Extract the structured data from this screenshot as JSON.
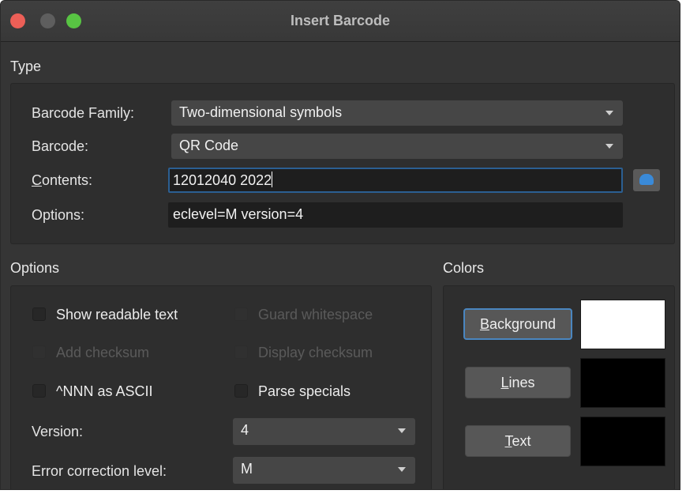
{
  "window": {
    "title": "Insert Barcode"
  },
  "type_section": {
    "label": "Type",
    "family_label": "Barcode Family:",
    "family_value": "Two-dimensional symbols",
    "barcode_label": "Barcode:",
    "barcode_value": "QR Code",
    "contents_label_rest": "ontents:",
    "contents_label_accel": "C",
    "contents_value": "12012040 2022",
    "options_label": "Options:",
    "options_value": "eclevel=M version=4"
  },
  "options_section": {
    "label": "Options",
    "checkboxes": [
      {
        "label": "Show readable text",
        "enabled": true,
        "checked": false
      },
      {
        "label": "Guard whitespace",
        "enabled": false,
        "checked": false
      },
      {
        "label": "Add checksum",
        "enabled": false,
        "checked": false
      },
      {
        "label": "Display checksum",
        "enabled": false,
        "checked": false
      },
      {
        "label": "^NNN as ASCII",
        "enabled": true,
        "checked": false
      },
      {
        "label": "Parse specials",
        "enabled": true,
        "checked": false
      }
    ],
    "version_label": "Version:",
    "version_value": "4",
    "ecl_label": "Error correction level:",
    "ecl_value": "M"
  },
  "colors_section": {
    "label": "Colors",
    "background_accel": "B",
    "background_rest": "ackground",
    "lines_accel": "L",
    "lines_rest": "ines",
    "text_accel": "T",
    "text_rest": "ext",
    "background_color": "#ffffff",
    "lines_color": "#000000",
    "text_color": "#000000"
  }
}
